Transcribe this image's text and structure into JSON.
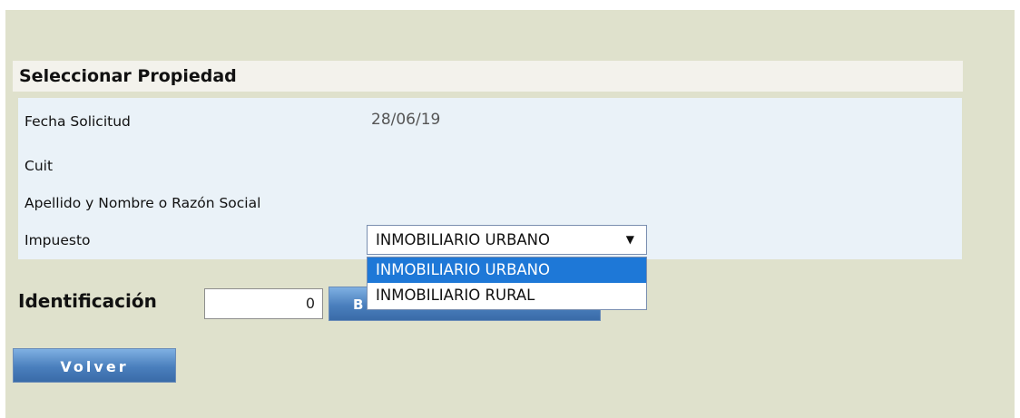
{
  "panel": {
    "title": "Seleccionar Propiedad"
  },
  "fields": {
    "fecha_label": "Fecha Solicitud",
    "fecha_value": "28/06/19",
    "cuit_label": "Cuit",
    "cuit_value": "",
    "nombre_label": "Apellido y Nombre o Razón Social",
    "nombre_value": "",
    "impuesto_label": "Impuesto",
    "impuesto_selected": "INMOBILIARIO URBANO"
  },
  "dropdown": {
    "options": [
      "INMOBILIARIO URBANO",
      "INMOBILIARIO RURAL"
    ],
    "highlighted_index": 0
  },
  "identificacion": {
    "label": "Identificación",
    "value": "0"
  },
  "buttons": {
    "buscar_visible_text": "B",
    "volver_label": "Volver"
  },
  "colors": {
    "page_background": "#dfe1cc",
    "panel_body": "#eaf2f8",
    "selection_highlight": "#1e78d7",
    "button_blue": "#4a7fbd"
  },
  "icons": {
    "select_arrow": "caret-down-icon"
  }
}
